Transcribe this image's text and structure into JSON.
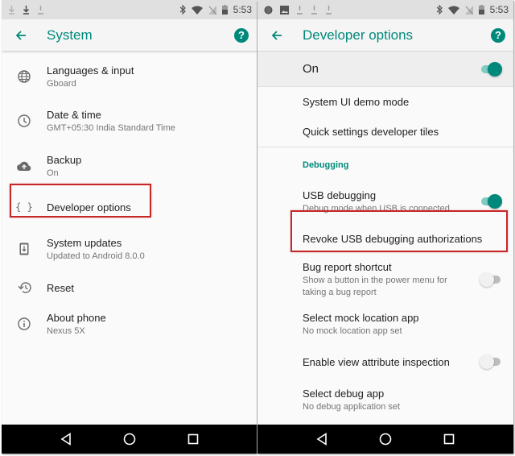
{
  "colors": {
    "accent": "#00897b",
    "highlight_border": "#c62828",
    "statusbar_bg": "#e0e0e0",
    "navbar_bg": "#000000"
  },
  "left": {
    "statusbar": {
      "notification_icons": [
        "download-icon",
        "download-icon",
        "download-icon"
      ],
      "system_icons": [
        "bluetooth-icon",
        "wifi-icon",
        "no-sim-icon",
        "battery-icon"
      ],
      "time": "5:53"
    },
    "toolbar": {
      "back_icon": "arrow-back-icon",
      "title": "System",
      "help_icon": "help-icon",
      "help_glyph": "?"
    },
    "items": [
      {
        "icon": "globe-icon",
        "title": "Languages & input",
        "subtitle": "Gboard"
      },
      {
        "icon": "clock-icon",
        "title": "Date & time",
        "subtitle": "GMT+05:30 India Standard Time"
      },
      {
        "icon": "cloud-upload-icon",
        "title": "Backup",
        "subtitle": "On"
      },
      {
        "icon": "code-braces-icon",
        "icon_glyph": "{ }",
        "title": "Developer options",
        "highlighted": true
      },
      {
        "icon": "system-update-icon",
        "title": "System updates",
        "subtitle": "Updated to Android 8.0.0"
      },
      {
        "icon": "restore-icon",
        "title": "Reset"
      },
      {
        "icon": "info-icon",
        "title": "About phone",
        "subtitle": "Nexus 5X"
      }
    ],
    "navbar": [
      "back-nav-icon",
      "home-nav-icon",
      "recents-nav-icon"
    ]
  },
  "right": {
    "statusbar": {
      "notification_icons": [
        "circle-icon",
        "image-icon",
        "download-icon",
        "download-icon",
        "download-icon"
      ],
      "system_icons": [
        "bluetooth-icon",
        "wifi-icon",
        "no-sim-icon",
        "battery-icon"
      ],
      "time": "5:53"
    },
    "toolbar": {
      "back_icon": "arrow-back-icon",
      "title": "Developer options",
      "help_icon": "help-icon",
      "help_glyph": "?"
    },
    "master_switch": {
      "label": "On",
      "state": "on"
    },
    "items_top": [
      {
        "title": "System UI demo mode"
      },
      {
        "title": "Quick settings developer tiles"
      }
    ],
    "section_header": "Debugging",
    "items_debug": [
      {
        "title": "USB debugging",
        "subtitle": "Debug mode when USB is connected",
        "toggle": "on",
        "highlighted": true
      },
      {
        "title": "Revoke USB debugging authorizations"
      },
      {
        "title": "Bug report shortcut",
        "subtitle": "Show a button in the power menu for taking a bug report",
        "toggle": "off"
      },
      {
        "title": "Select mock location app",
        "subtitle": "No mock location app set"
      },
      {
        "title": "Enable view attribute inspection",
        "toggle": "off"
      },
      {
        "title": "Select debug app",
        "subtitle": "No debug application set"
      }
    ],
    "navbar": [
      "back-nav-icon",
      "home-nav-icon",
      "recents-nav-icon"
    ]
  }
}
